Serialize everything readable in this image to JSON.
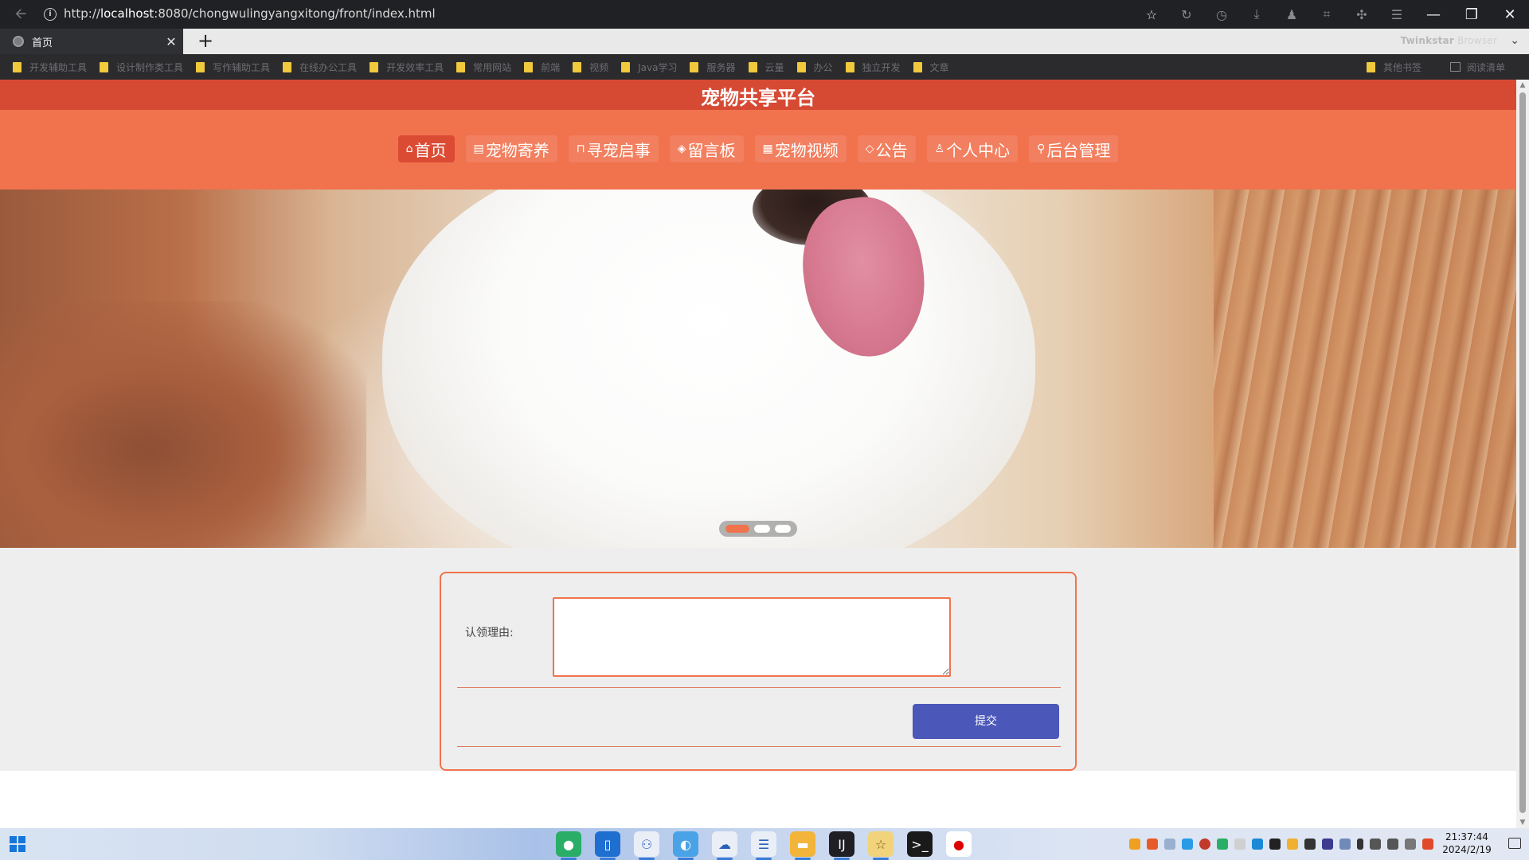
{
  "browser": {
    "url_prefix": "http://",
    "url_host": "localhost",
    "url_rest": ":8080/chongwulingyangxitong/front/index.html",
    "tab_title": "首页",
    "tab_close": "✕",
    "new_tab": "+",
    "brand_bold": "Twinkstar",
    "brand_light": " Browser",
    "bookmarks": [
      "开发辅助工具",
      "设计制作类工具",
      "写作辅助工具",
      "在线办公工具",
      "开发效率工具",
      "常用网站",
      "前端",
      "视频",
      "Java学习",
      "服务器",
      "云量",
      "办公",
      "独立开发",
      "文章"
    ],
    "bookmarks_right": [
      "其他书签",
      "阅读清单"
    ]
  },
  "site": {
    "title": "宠物共享平台",
    "nav": [
      {
        "icon": "⌂",
        "label": "首页"
      },
      {
        "icon": "▤",
        "label": "宠物寄养"
      },
      {
        "icon": "⊓",
        "label": "寻宠启事"
      },
      {
        "icon": "◈",
        "label": "留言板"
      },
      {
        "icon": "▦",
        "label": "宠物视频"
      },
      {
        "icon": "◇",
        "label": "公告"
      },
      {
        "icon": "♙",
        "label": "个人中心"
      },
      {
        "icon": "⚲",
        "label": "后台管理"
      }
    ],
    "active_nav_index": 0
  },
  "carousel": {
    "slide_count": 3,
    "active_slide": 1
  },
  "form": {
    "reason_label": "认领理由:",
    "reason_value": "",
    "submit_label": "提交"
  },
  "taskbar": {
    "time": "21:37:44",
    "date": "2024/2/19"
  },
  "colors": {
    "header_dark": "#d64a34",
    "header_light": "#f0734e",
    "nav_active": "#db4b34",
    "submit_button": "#4b57b9"
  }
}
